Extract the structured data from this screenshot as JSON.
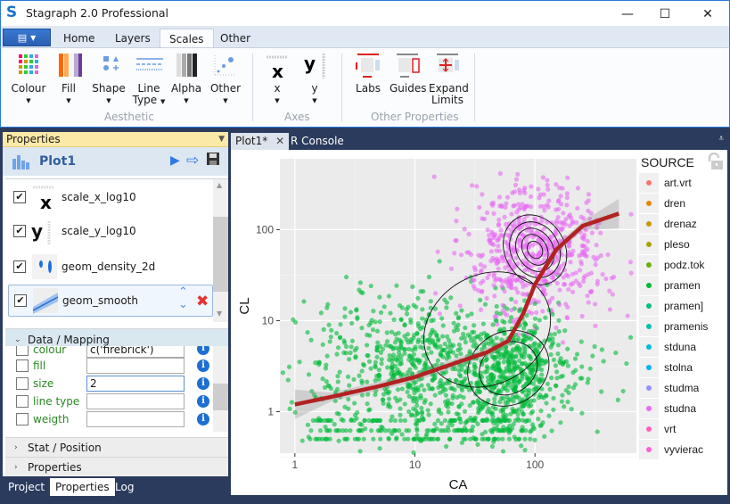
{
  "window": {
    "title": "Stagraph 2.0 Professional",
    "logo": "S",
    "controls": {
      "minimize": "—",
      "maximize": "☐",
      "close": "✕"
    }
  },
  "ribbon": {
    "file_menu_icon": "menu-icon",
    "tabs": [
      {
        "label": "Home",
        "active": false
      },
      {
        "label": "Layers",
        "active": false
      },
      {
        "label": "Scales",
        "active": true
      },
      {
        "label": "Other",
        "active": false
      }
    ],
    "groups": {
      "aesthetic": {
        "label": "Aesthetic",
        "buttons": [
          {
            "label": "Colour",
            "dropdown": true
          },
          {
            "label": "Fill",
            "dropdown": true
          },
          {
            "label": "Shape",
            "dropdown": true
          },
          {
            "label": "Line",
            "label2": "Type",
            "dropdown": true
          },
          {
            "label": "Alpha",
            "dropdown": true
          },
          {
            "label": "Other",
            "dropdown": true
          }
        ]
      },
      "axes": {
        "label": "Axes",
        "buttons": [
          {
            "label": "x",
            "glyph": "x",
            "dropdown": true
          },
          {
            "label": "y",
            "glyph": "y",
            "dropdown": true
          }
        ]
      },
      "other_properties": {
        "label": "Other Properties",
        "buttons": [
          {
            "label": "Labs"
          },
          {
            "label": "Guides"
          },
          {
            "label": "Expand",
            "label2": "Limits"
          }
        ]
      }
    }
  },
  "properties_panel": {
    "header": "Properties",
    "plot_name": "Plot1",
    "layers": [
      {
        "name": "scale_x_log10",
        "checked": true,
        "icon": "x-scale-icon"
      },
      {
        "name": "scale_y_log10",
        "checked": true,
        "icon": "y-scale-icon"
      },
      {
        "name": "geom_density_2d",
        "checked": true,
        "icon": "density-2d-icon"
      },
      {
        "name": "geom_smooth",
        "checked": true,
        "icon": "smooth-icon",
        "selected": true
      }
    ],
    "sections": {
      "data_mapping": "Data / Mapping",
      "stat_position": "Stat / Position",
      "properties": "Properties"
    },
    "mappings": [
      {
        "label": "colour",
        "value": "c('firebrick')"
      },
      {
        "label": "fill",
        "value": ""
      },
      {
        "label": "size",
        "value": "2"
      },
      {
        "label": "line type",
        "value": ""
      },
      {
        "label": "weigth",
        "value": ""
      }
    ],
    "info_glyph": "i",
    "bottom_tabs": [
      {
        "label": "Project",
        "active": false
      },
      {
        "label": "Properties",
        "active": true
      },
      {
        "label": "Log",
        "active": false
      }
    ]
  },
  "document_tabs": [
    {
      "label": "Plot1*",
      "active": true,
      "closable": true
    },
    {
      "label": "R Console",
      "active": false
    }
  ],
  "chart_data": {
    "type": "scatter",
    "title": "",
    "xlabel": "CA",
    "ylabel": "CL",
    "x_scale": "log10",
    "y_scale": "log10",
    "x_ticks": [
      "1",
      "10",
      "100"
    ],
    "y_ticks": [
      "1",
      "10",
      "100"
    ],
    "xlim": [
      0.75,
      700
    ],
    "ylim": [
      0.35,
      600
    ],
    "grid": true,
    "layers": [
      "points",
      "density_2d contours",
      "smooth line with CI band"
    ],
    "smooth_color": "#b22222",
    "smooth_line": {
      "x": [
        1,
        2,
        5,
        10,
        20,
        40,
        60,
        80,
        100,
        150,
        250,
        500
      ],
      "y": [
        1.2,
        1.45,
        1.9,
        2.4,
        3.3,
        4.5,
        6,
        12,
        25,
        60,
        110,
        150
      ]
    },
    "legend": {
      "title": "SOURCE",
      "position": "right",
      "entries": [
        {
          "label": "art.vrt",
          "color": "#f8766d"
        },
        {
          "label": "dren",
          "color": "#e58700"
        },
        {
          "label": "drenaz",
          "color": "#c99800"
        },
        {
          "label": "pleso",
          "color": "#a3a500"
        },
        {
          "label": "podz.tok",
          "color": "#6bb100"
        },
        {
          "label": "pramen",
          "color": "#00ba38"
        },
        {
          "label": "pramen]",
          "color": "#00bf7d"
        },
        {
          "label": "pramenis",
          "color": "#00c0af"
        },
        {
          "label": "stduna",
          "color": "#00bcd8"
        },
        {
          "label": "stolna",
          "color": "#00b0f6"
        },
        {
          "label": "studma",
          "color": "#9590ff"
        },
        {
          "label": "studna",
          "color": "#e76bf3"
        },
        {
          "label": "vrt",
          "color": "#ff62bc"
        },
        {
          "label": "vyvierac",
          "color": "#fd61d1"
        }
      ]
    },
    "clusters": [
      {
        "series": "pramen",
        "color": "#00ba38",
        "center": [
          15,
          3
        ],
        "spread": [
          0.55,
          0.4
        ],
        "n": 900
      },
      {
        "series": "studna",
        "color": "#e76bf3",
        "center": [
          100,
          60
        ],
        "spread": [
          0.3,
          0.35
        ],
        "n": 600
      },
      {
        "series": "pramen",
        "color": "#00ba38",
        "center": [
          70,
          2.5
        ],
        "spread": [
          0.2,
          0.3
        ],
        "n": 350
      }
    ]
  }
}
